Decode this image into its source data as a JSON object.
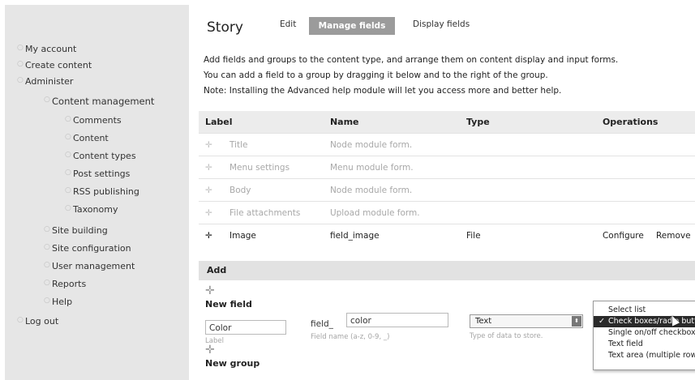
{
  "sidebar": {
    "items": [
      {
        "label": "My account"
      },
      {
        "label": "Create content"
      },
      {
        "label": "Administer"
      },
      {
        "label": "Content management"
      },
      {
        "label": "Comments"
      },
      {
        "label": "Content"
      },
      {
        "label": "Content types"
      },
      {
        "label": "Post settings"
      },
      {
        "label": "RSS publishing"
      },
      {
        "label": "Taxonomy"
      },
      {
        "label": "Site building"
      },
      {
        "label": "Site configuration"
      },
      {
        "label": "User management"
      },
      {
        "label": "Reports"
      },
      {
        "label": "Help"
      },
      {
        "label": "Log out"
      }
    ]
  },
  "header": {
    "title": "Story",
    "tabs": [
      {
        "label": "Edit"
      },
      {
        "label": "Manage fields"
      },
      {
        "label": "Display fields"
      }
    ]
  },
  "help": {
    "line1": "Add fields and groups to the content type, and arrange them on content display and input forms.",
    "line2": "You can add a field to a group by dragging it below and to the right of the group.",
    "line3": "Note: Installing the Advanced help module will let you access more and better help."
  },
  "table": {
    "headers": {
      "label": "Label",
      "name": "Name",
      "type": "Type",
      "operations": "Operations"
    },
    "rows": [
      {
        "label": "Title",
        "name": "Node module form.",
        "type": "",
        "configure": "",
        "remove": ""
      },
      {
        "label": "Menu settings",
        "name": "Menu module form.",
        "type": "",
        "configure": "",
        "remove": ""
      },
      {
        "label": "Body",
        "name": "Node module form.",
        "type": "",
        "configure": "",
        "remove": ""
      },
      {
        "label": "File attachments",
        "name": "Upload module form.",
        "type": "",
        "configure": "",
        "remove": ""
      },
      {
        "label": "Image",
        "name": "field_image",
        "type": "File",
        "configure": "Configure",
        "remove": "Remove"
      }
    ]
  },
  "add": {
    "header": "Add",
    "new_field": {
      "title": "New field",
      "label_value": "Color",
      "label_hint": "Label",
      "name_prefix": "field_",
      "name_value": "color",
      "name_hint": "Field name (a-z, 0-9, _)",
      "type_selected": "Text",
      "type_hint": "Type of data to store."
    },
    "new_group": {
      "title": "New group"
    }
  },
  "widget_dropdown": {
    "options": [
      {
        "label": "Select list",
        "selected": false
      },
      {
        "label": "Check boxes/radio buttons",
        "selected": true
      },
      {
        "label": "Single on/off checkbox",
        "selected": false
      },
      {
        "label": "Text field",
        "selected": false
      },
      {
        "label": "Text area (multiple rows)",
        "selected": false
      }
    ],
    "check_mark": "✓"
  },
  "colors": {
    "sidebar_bg": "#e6e6e6",
    "active_tab_bg": "#9b9b9b",
    "selected_option_bg": "#2a2a2a"
  }
}
